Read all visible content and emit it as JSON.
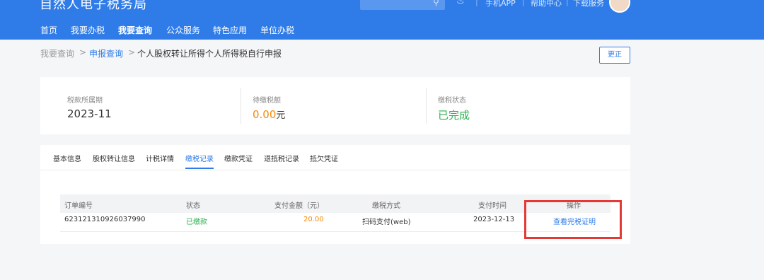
{
  "header": {
    "brand": "自然人电子税务局",
    "links": [
      "手机APP",
      "帮助中心",
      "下载服务"
    ],
    "nav": [
      "首页",
      "我要办税",
      "我要查询",
      "公众服务",
      "特色应用",
      "单位办税"
    ]
  },
  "breadcrumb": {
    "items": [
      "我要查询",
      "申报查询",
      "个人股权转让所得个人所得税自行申报"
    ],
    "separator": ">"
  },
  "actions": {
    "correct_label": "更正"
  },
  "summary": [
    {
      "label": "税款所属期",
      "value": "2023-11"
    },
    {
      "label": "待缴税额",
      "value": "0.00",
      "unit": "元"
    },
    {
      "label": "缴税状态",
      "value": "已完成"
    }
  ],
  "tabs": [
    "基本信息",
    "股权转让信息",
    "计税详情",
    "缴税记录",
    "缴款凭证",
    "退抵税记录",
    "抵欠凭证"
  ],
  "active_tab": "缴税记录",
  "table": {
    "headers": [
      "订单编号",
      "状态",
      "支付金额（元）",
      "缴税方式",
      "支付时间",
      "操作"
    ],
    "rows": [
      {
        "order_no": "623121310926037990",
        "status": "已缴款",
        "amount": "20.00",
        "method": "扫码支付(web)",
        "time": "2023-12-13",
        "action": "查看完税证明"
      }
    ]
  },
  "colors": {
    "primary": "#2f7ce8",
    "orange": "#f5890a",
    "green": "#2bb24c",
    "highlight": "#e53935"
  }
}
